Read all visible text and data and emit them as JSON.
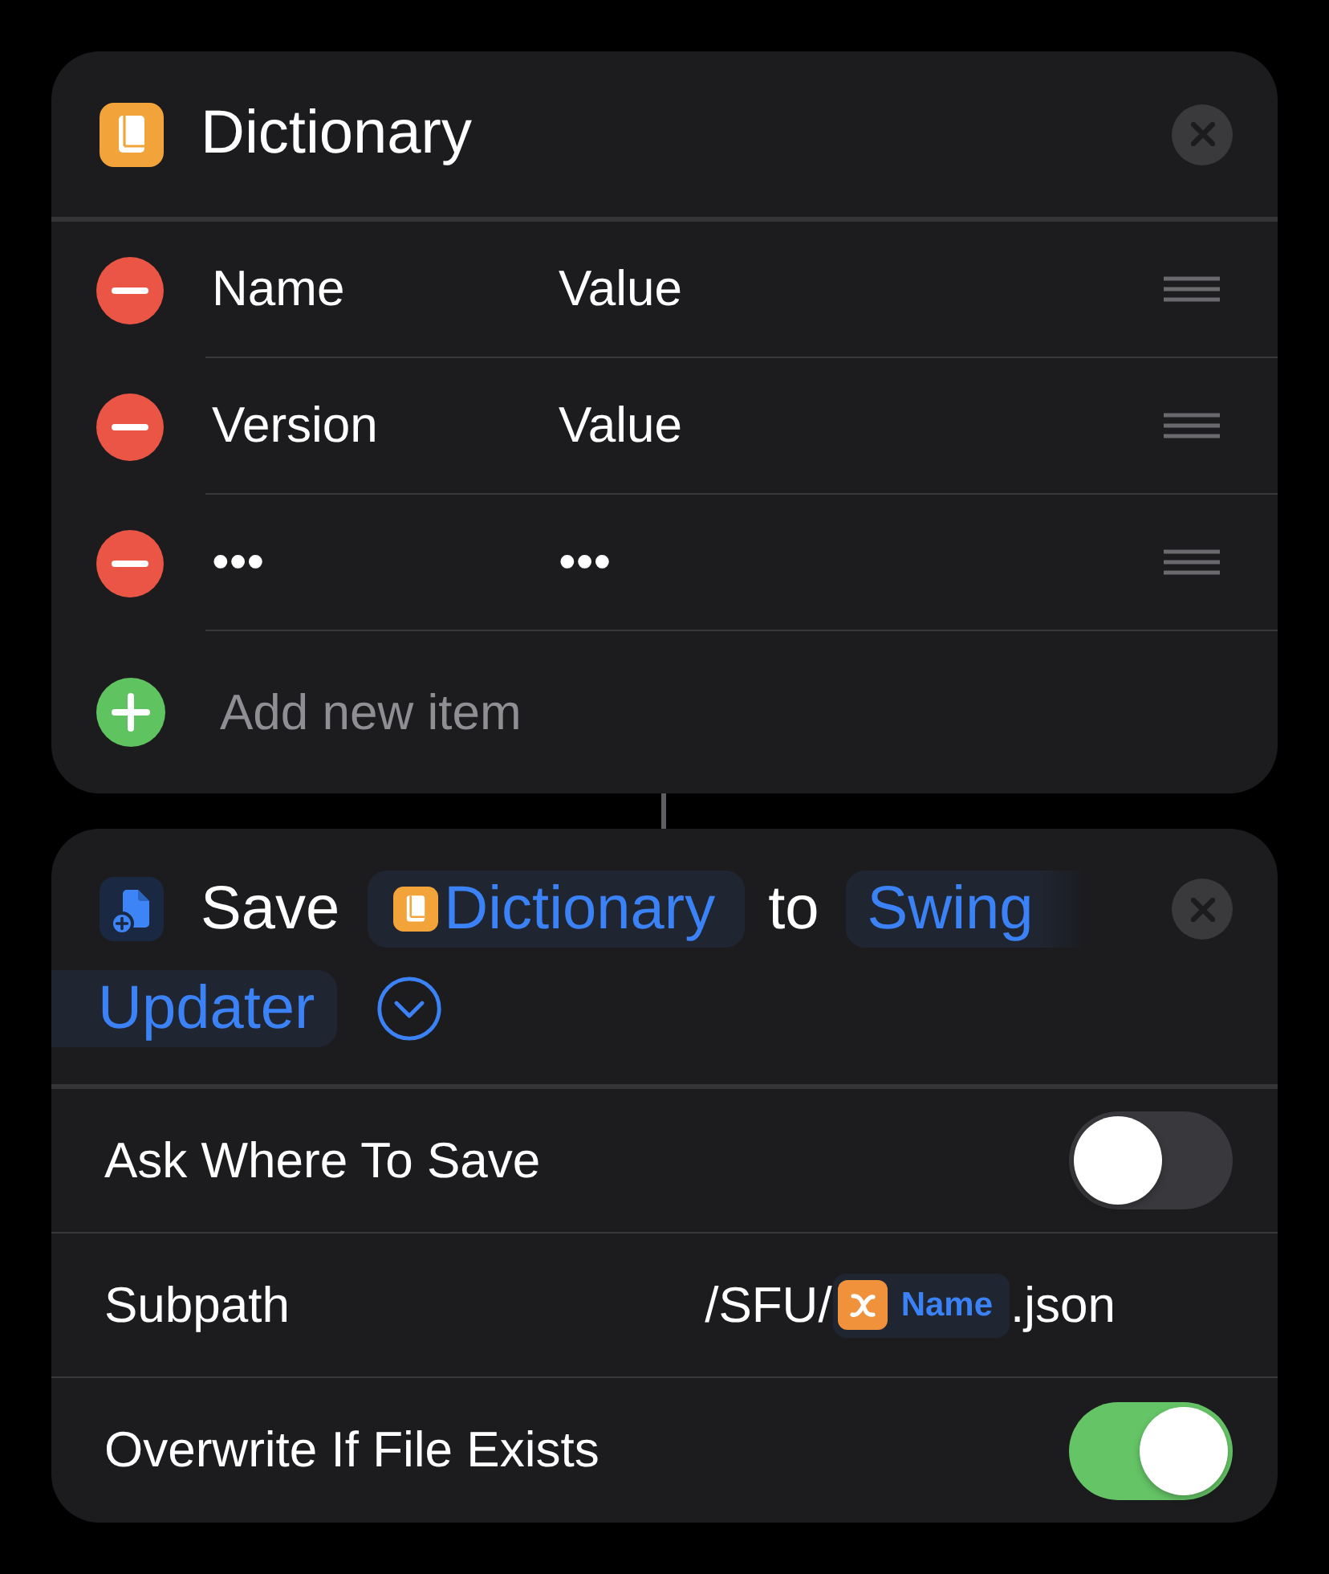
{
  "dictionary_card": {
    "title": "Dictionary",
    "items": [
      {
        "key": "Name",
        "value": "Value"
      },
      {
        "key": "Version",
        "value": "Value"
      },
      {
        "key": "•••",
        "value": "•••"
      }
    ],
    "add_label": "Add new item"
  },
  "save_card": {
    "verb": "Save",
    "input_token": "Dictionary",
    "preposition": "to",
    "destination_token_lines": [
      "Swing",
      "Updater"
    ]
  },
  "options": [
    {
      "kind": "toggle",
      "label": "Ask Where To Save",
      "on": false
    },
    {
      "kind": "path",
      "label": "Subpath",
      "prefix": "/SFU/",
      "variable": "Name",
      "suffix": ".json"
    },
    {
      "kind": "toggle",
      "label": "Overwrite If File Exists",
      "on": true
    }
  ]
}
